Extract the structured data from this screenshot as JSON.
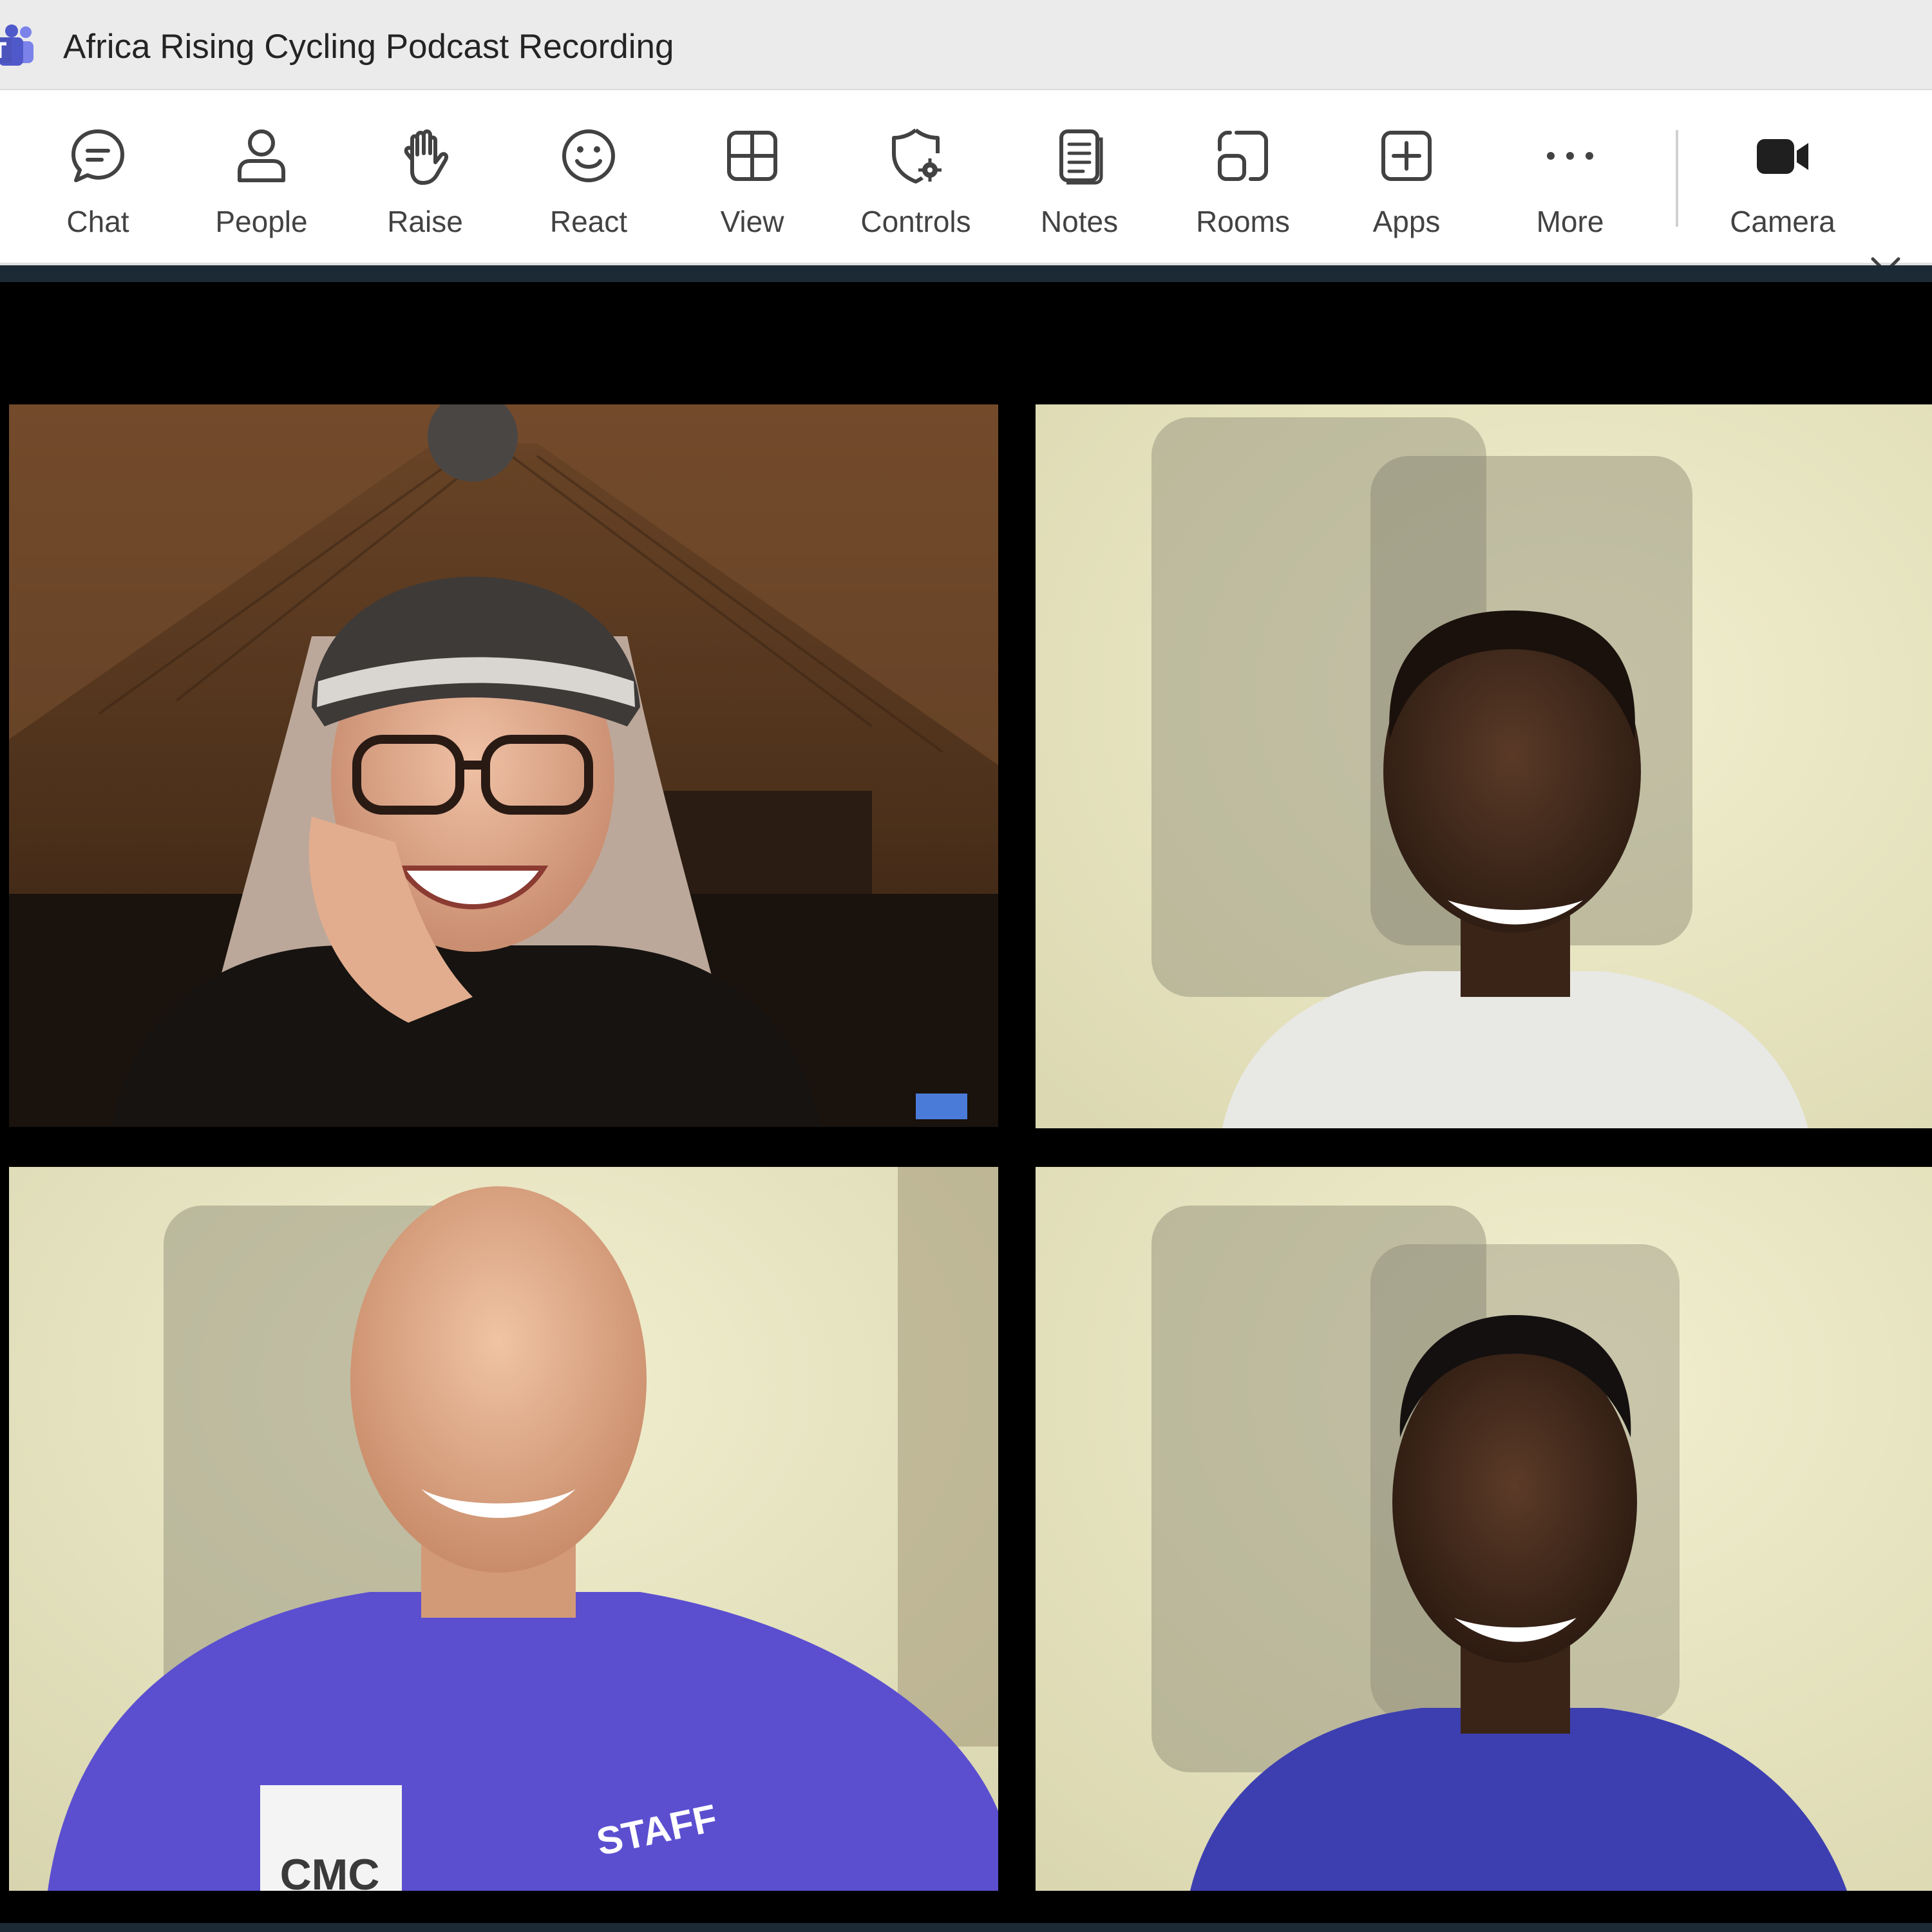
{
  "window": {
    "title": "Africa Rising Cycling Podcast Recording",
    "app_icon": "teams-logo-icon"
  },
  "toolbar": {
    "items": [
      {
        "label": "Chat",
        "icon": "chat-icon"
      },
      {
        "label": "People",
        "icon": "people-icon"
      },
      {
        "label": "Raise",
        "icon": "raise-hand-icon"
      },
      {
        "label": "React",
        "icon": "react-smiley-icon"
      },
      {
        "label": "View",
        "icon": "view-grid-icon"
      },
      {
        "label": "Controls",
        "icon": "controls-shield-icon"
      },
      {
        "label": "Notes",
        "icon": "notes-icon"
      },
      {
        "label": "Rooms",
        "icon": "rooms-icon"
      },
      {
        "label": "Apps",
        "icon": "apps-plus-icon"
      },
      {
        "label": "More",
        "icon": "more-ellipsis-icon"
      },
      {
        "label": "Camera",
        "icon": "camera-icon"
      }
    ],
    "camera_options_icon": "chevron-down-icon"
  },
  "participants": [
    {
      "tile": "video-tile-1",
      "background": "wood-cabin",
      "shirt_color": "#1a1a1a"
    },
    {
      "tile": "video-tile-2",
      "background": "blurred-cream-wall",
      "shirt_color": "#e8e8e4"
    },
    {
      "tile": "video-tile-3",
      "background": "blurred-cream-wall",
      "shirt_color": "#5b4fd0",
      "shirt_text": [
        "CMC",
        "STAFF"
      ]
    },
    {
      "tile": "video-tile-4",
      "background": "blurred-cream-wall",
      "shirt_color": "#3d3fb0"
    }
  ],
  "colors": {
    "titlebar": "#ebebeb",
    "toolbar": "#ffffff",
    "stage": "#000000",
    "icon_stroke": "#424242",
    "teams_purple": "#5b5fc7"
  }
}
